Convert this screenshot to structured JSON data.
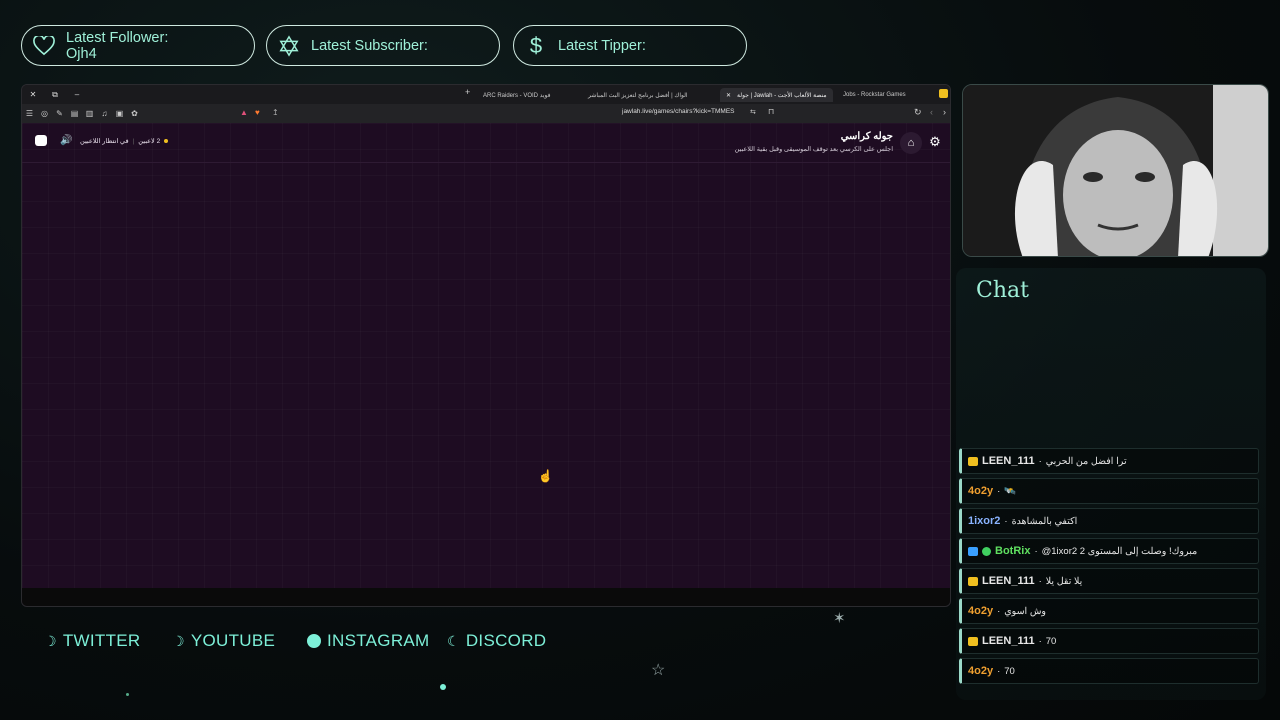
{
  "alerts": {
    "follower": {
      "title": "Latest Follower:",
      "value": "Ojh4",
      "icon": "heart-icon"
    },
    "subscriber": {
      "title": "Latest Subscriber:",
      "value": "",
      "icon": "star-of-david-icon"
    },
    "tipper": {
      "title": "Latest Tipper:",
      "value": "",
      "icon": "dollar-icon"
    }
  },
  "browser": {
    "tabs": [
      {
        "label": "ARC Raiders - VOID فويد"
      },
      {
        "label": "الواك | أفضل برنامج لتعزيز البث المباشر"
      },
      {
        "label": "جولة | Jawlah - منصة الألعاب الأجت"
      },
      {
        "label": "Jobs - Rockstar Games"
      }
    ],
    "url": "jawlah.live/games/chairs?kick=TMMES",
    "page": {
      "title": "جوله كراسي",
      "subtitle": "اجلس على الكرسي بعد توقف الموسيقى وقبل بقية اللاعبين",
      "players_count": "2 لاعبين",
      "players_status": "في انتظار اللاعبين"
    }
  },
  "chat": {
    "title": "Chat",
    "messages": [
      {
        "user": "LEEN_111",
        "color": "#e8e8e8",
        "badge": "crown",
        "text": "ترا افضل من الحربي"
      },
      {
        "user": "4o2y",
        "color": "#f0a030",
        "badge": "",
        "text": "🛰️"
      },
      {
        "user": "1ixor2",
        "color": "#8ab4ff",
        "badge": "",
        "text": "اكتفي بالمشاهدة"
      },
      {
        "user": "BotRix",
        "color": "#60e060",
        "badge": "bot",
        "text": "@1ixor2 مبروك! وصلت إلى المستوى 2"
      },
      {
        "user": "LEEN_111",
        "color": "#e8e8e8",
        "badge": "crown",
        "text": "يلا تقل يلا"
      },
      {
        "user": "4o2y",
        "color": "#f0a030",
        "badge": "",
        "text": "وش اسوي"
      },
      {
        "user": "LEEN_111",
        "color": "#e8e8e8",
        "badge": "crown",
        "text": "70"
      },
      {
        "user": "4o2y",
        "color": "#f0a030",
        "badge": "",
        "text": "70"
      }
    ]
  },
  "socials": [
    {
      "label": "TWITTER",
      "icon": "moon-icon"
    },
    {
      "label": "YOUTUBE",
      "icon": "moon-icon"
    },
    {
      "label": "INSTAGRAM",
      "icon": "circle-icon"
    },
    {
      "label": "DISCORD",
      "icon": "moon-left-icon"
    }
  ],
  "colors": {
    "accent": "#9ff0d8",
    "social": "#7df0d8",
    "page_bg": "#1e0c22"
  }
}
